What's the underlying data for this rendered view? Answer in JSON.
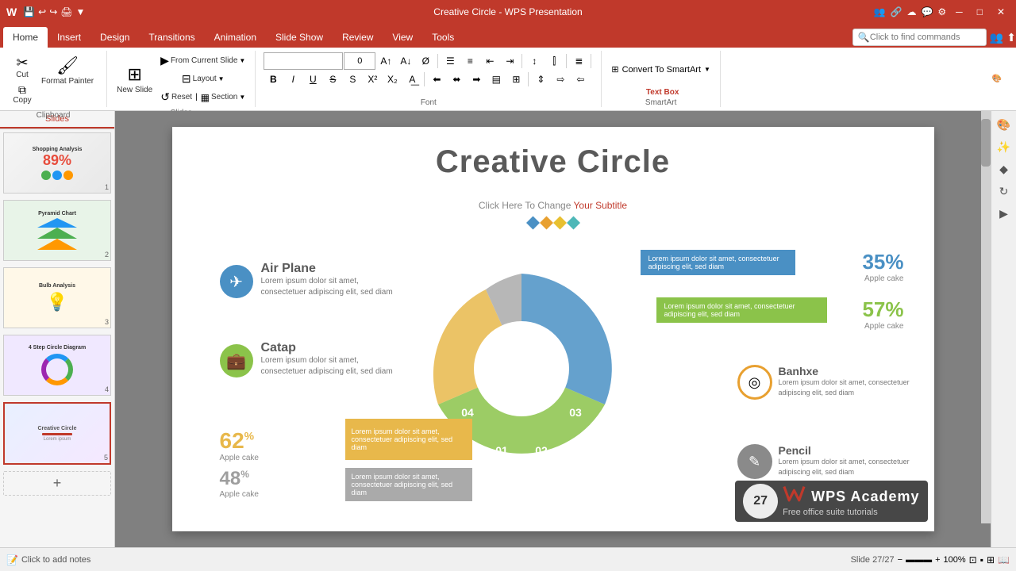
{
  "titlebar": {
    "title": "Creative Circle - WPS Presentation",
    "buttons": [
      "minimize",
      "maximize",
      "close"
    ]
  },
  "tabs": [
    {
      "id": "home",
      "label": "Home",
      "active": true
    },
    {
      "id": "insert",
      "label": "Insert"
    },
    {
      "id": "design",
      "label": "Design"
    },
    {
      "id": "transitions",
      "label": "Transitions"
    },
    {
      "id": "animation",
      "label": "Animation"
    },
    {
      "id": "slideshow",
      "label": "Slide Show"
    },
    {
      "id": "review",
      "label": "Review"
    },
    {
      "id": "view",
      "label": "View"
    },
    {
      "id": "tools",
      "label": "Tools"
    }
  ],
  "ribbon": {
    "groups": [
      {
        "id": "clipboard",
        "label": "Clipboard",
        "buttons": [
          {
            "id": "cut",
            "icon": "✂",
            "label": "Cut"
          },
          {
            "id": "copy",
            "icon": "⧉",
            "label": "Copy"
          },
          {
            "id": "format-painter",
            "icon": "🖌",
            "label": "Format Painter"
          }
        ]
      },
      {
        "id": "slides",
        "label": "Slides",
        "buttons": [
          {
            "id": "new-slide",
            "icon": "⊞",
            "label": "New Slide"
          },
          {
            "id": "from-current",
            "icon": "▶",
            "label": "From Current Slide"
          },
          {
            "id": "layout",
            "icon": "⊟",
            "label": "Layout"
          },
          {
            "id": "reset",
            "icon": "↺",
            "label": "Reset"
          },
          {
            "id": "section",
            "icon": "▦",
            "label": "Section"
          }
        ]
      },
      {
        "id": "font",
        "label": "Font",
        "font_name": "",
        "font_size": "0",
        "buttons": [
          "increase-size",
          "decrease-size",
          "clear-format",
          "bullets",
          "numbering",
          "decrease-indent",
          "increase-indent",
          "line-spacing",
          "columns",
          "align-text",
          "bold",
          "italic",
          "underline",
          "strikethrough",
          "superscript",
          "subscript",
          "text-highlight",
          "font-color"
        ]
      }
    ],
    "search": {
      "placeholder": "Click to find commands"
    }
  },
  "slides_panel": {
    "tabs": [
      {
        "id": "slides",
        "label": "Slides",
        "active": true
      }
    ],
    "slides": [
      {
        "id": 1,
        "type": "shopping-analysis"
      },
      {
        "id": 2,
        "type": "pyramid-chart"
      },
      {
        "id": 3,
        "type": "bulb-analysis"
      },
      {
        "id": 4,
        "type": "step-circle"
      },
      {
        "id": 5,
        "type": "creative-circle",
        "active": true
      }
    ]
  },
  "slide": {
    "title": "Creative Circle",
    "subtitle_pre": "Click Here To Change ",
    "subtitle_highlight": "Your Subtitle",
    "diamonds": [
      "#4a90c4",
      "#e8a030",
      "#e8c030",
      "#4eb8b8"
    ],
    "items_left": [
      {
        "id": "airplane",
        "icon": "✈",
        "color": "blue",
        "title": "Air Plane",
        "text": "Lorem ipsum dolor sit amet, consectetuer adipiscing elit, sed diam"
      },
      {
        "id": "catap",
        "icon": "💼",
        "color": "green",
        "title": "Catap",
        "text": "Lorem ipsum dolor sit amet, consectetuer adipiscing elit, sed diam"
      }
    ],
    "stats_left": [
      {
        "id": "stat62",
        "value": "62",
        "suffix": "%",
        "label": "Apple cake",
        "color": "#e8b84b"
      },
      {
        "id": "stat48",
        "value": "48",
        "suffix": "%",
        "label": "Apple cake",
        "color": "#9e9e9e"
      }
    ],
    "stats_right": [
      {
        "id": "stat35",
        "value": "35%",
        "label": "Apple cake",
        "color": "#4a90c4",
        "text": "Lorem ipsum dolor sit amet, consectetuer adipiscing elit, sed diam"
      },
      {
        "id": "stat57",
        "value": "57%",
        "label": "Apple cake",
        "color": "#8bc34a",
        "text": "Lorem ipsum dolor sit amet, consectetuer adipiscing elit, sed diam"
      }
    ],
    "items_right": [
      {
        "id": "banhxe",
        "icon": "◎",
        "color": "orange-ring",
        "title": "Banhxe",
        "text": "Lorem ipsum dolor sit amet, consectetuer adipiscing elit, sed diam"
      },
      {
        "id": "pencil",
        "icon": "✎",
        "color": "gray-ring",
        "title": "Pencil",
        "text": "Lorem ipsum dolor sit amet, consectetuer adipiscing elit, sed diam"
      }
    ],
    "circle_numbers": [
      "01",
      "02",
      "03",
      "04"
    ],
    "orange_bar_text": "Lorem ipsum dolor sit amet, consectetuer adipiscing elit, sed diam",
    "gray_bar_text": "Lorem ipsum dolor sit amet, consectetuer adipiscing elit, sed diam"
  },
  "bottom": {
    "add_notes": "Click to add notes",
    "slide_indicator": "27"
  },
  "wps": {
    "badge": "27",
    "tagline": "Free office suite tutorials"
  }
}
